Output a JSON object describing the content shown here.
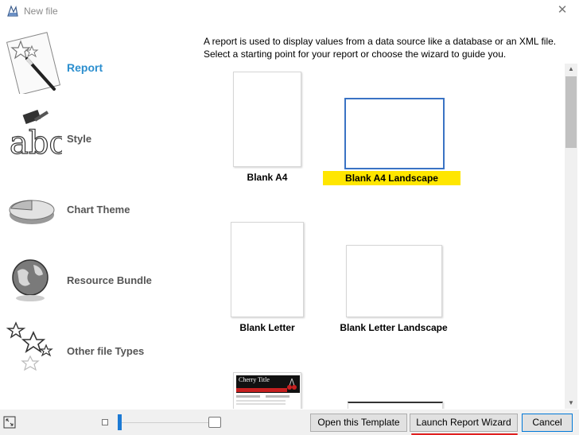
{
  "window": {
    "title": "New file"
  },
  "sidebar": {
    "items": [
      {
        "label": "Report",
        "icon": "report-icon",
        "active": true
      },
      {
        "label": "Style",
        "icon": "style-icon",
        "active": false
      },
      {
        "label": "Chart Theme",
        "icon": "chart-theme-icon",
        "active": false
      },
      {
        "label": "Resource Bundle",
        "icon": "globe-icon",
        "active": false
      },
      {
        "label": "Other file Types",
        "icon": "stars-icon",
        "active": false
      }
    ]
  },
  "description": {
    "line1": "A report is used to display values from a data source like a database or an XML file.",
    "line2": "Select a starting point for your report or choose the wizard to guide you."
  },
  "templates": [
    {
      "label": "Blank A4",
      "selected": false
    },
    {
      "label": "Blank A4 Landscape",
      "selected": true
    },
    {
      "label": "Blank Letter",
      "selected": false
    },
    {
      "label": "Blank Letter Landscape",
      "selected": false
    },
    {
      "label": "Cherry Title",
      "selected": false
    }
  ],
  "footer": {
    "open_template_label": "Open this Template",
    "launch_wizard_label": "Launch Report Wizard",
    "cancel_label": "Cancel"
  },
  "colors": {
    "accent": "#2c8fcf",
    "selection_highlight": "#ffe600",
    "selection_border": "#3a73c4",
    "wizard_underline": "#e02020"
  }
}
